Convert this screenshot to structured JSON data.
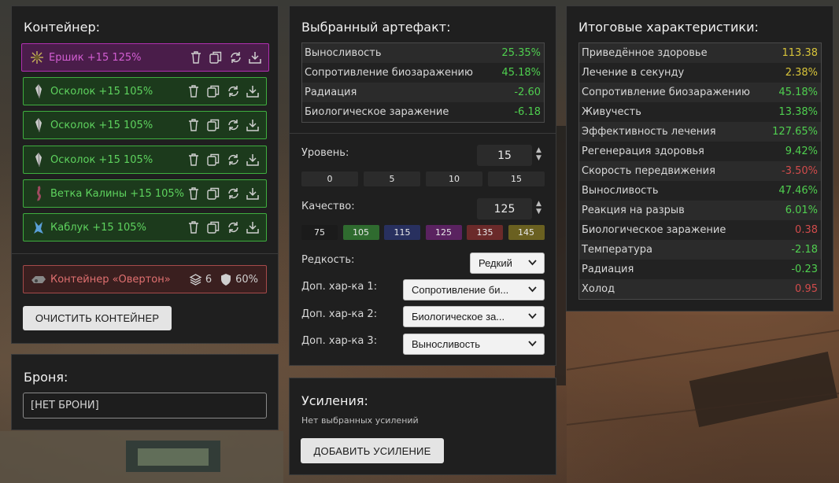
{
  "colors": {
    "green": "#4fcf4f",
    "yellow": "#d8c43a",
    "red": "#d14b4b",
    "selected_border": "#b02fb0",
    "item_border": "#3fae3f",
    "container_border": "#a64a4a"
  },
  "container": {
    "title": "Контейнер:",
    "items": [
      {
        "name": "Ершик +15 125%",
        "icon": "ershik-icon",
        "selected": true
      },
      {
        "name": "Осколок +15 105%",
        "icon": "oskolok-icon"
      },
      {
        "name": "Осколок +15 105%",
        "icon": "oskolok-icon"
      },
      {
        "name": "Осколок +15 105%",
        "icon": "oskolok-icon"
      },
      {
        "name": "Ветка Калины +15 105%",
        "icon": "vetka-icon"
      },
      {
        "name": "Каблук +15 105%",
        "icon": "kabluk-icon"
      }
    ],
    "container_item": {
      "name": "Контейнер «Овертон»",
      "slots": "6",
      "protection": "60%"
    },
    "clear_button": "ОЧИСТИТЬ КОНТЕЙНЕР"
  },
  "armor": {
    "title": "Броня:",
    "value": "[НЕТ БРОНИ]"
  },
  "artifact": {
    "title": "Выбранный артефакт:",
    "stats": [
      {
        "label": "Выносливость",
        "value": "25.35%",
        "color": "green"
      },
      {
        "label": "Сопротивление биозаражению",
        "value": "45.18%",
        "color": "green"
      },
      {
        "label": "Радиация",
        "value": "-2.60",
        "color": "green"
      },
      {
        "label": "Биологическое заражение",
        "value": "-6.18",
        "color": "green"
      }
    ],
    "level_label": "Уровень:",
    "level_value": "15",
    "level_presets": [
      "0",
      "5",
      "10",
      "15"
    ],
    "quality_label": "Качество:",
    "quality_value": "125",
    "quality_presets": [
      {
        "label": "75",
        "bg": "#1b1b1b"
      },
      {
        "label": "105",
        "bg": "#2f6b2f"
      },
      {
        "label": "115",
        "bg": "#28305f"
      },
      {
        "label": "125",
        "bg": "#5a2260"
      },
      {
        "label": "135",
        "bg": "#6b2a2a"
      },
      {
        "label": "145",
        "bg": "#6a6020"
      }
    ],
    "rarity_label": "Редкость:",
    "rarity_value": "Редкий",
    "extra1_label": "Доп. хар-ка 1:",
    "extra1_value": "Сопротивление би...",
    "extra2_label": "Доп. хар-ка 2:",
    "extra2_value": "Биологическое за...",
    "extra3_label": "Доп. хар-ка 3:",
    "extra3_value": "Выносливость"
  },
  "boosts": {
    "title": "Усиления:",
    "empty": "Нет выбранных усилений",
    "add_button": "ДОБАВИТЬ УСИЛЕНИЕ"
  },
  "totals": {
    "title": "Итоговые характеристики:",
    "stats": [
      {
        "label": "Приведённое здоровье",
        "value": "113.38",
        "color": "yellow"
      },
      {
        "label": "Лечение в секунду",
        "value": "2.38%",
        "color": "yellow"
      },
      {
        "label": "Сопротивление биозаражению",
        "value": "45.18%",
        "color": "green"
      },
      {
        "label": "Живучесть",
        "value": "13.38%",
        "color": "green"
      },
      {
        "label": "Эффективность лечения",
        "value": "127.65%",
        "color": "green"
      },
      {
        "label": "Регенерация здоровья",
        "value": "9.42%",
        "color": "green"
      },
      {
        "label": "Скорость передвижения",
        "value": "-3.50%",
        "color": "red"
      },
      {
        "label": "Выносливость",
        "value": "47.46%",
        "color": "green"
      },
      {
        "label": "Реакция на разрыв",
        "value": "6.01%",
        "color": "green"
      },
      {
        "label": "Биологическое заражение",
        "value": "0.38",
        "color": "red"
      },
      {
        "label": "Температура",
        "value": "-2.18",
        "color": "green"
      },
      {
        "label": "Радиация",
        "value": "-0.23",
        "color": "green"
      },
      {
        "label": "Холод",
        "value": "0.95",
        "color": "red"
      }
    ]
  }
}
